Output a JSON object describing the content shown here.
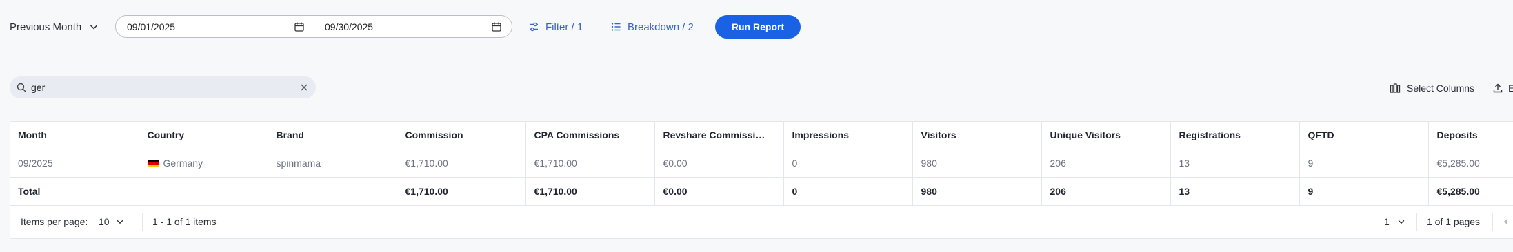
{
  "toolbar": {
    "period_label": "Previous Month",
    "date_from": "09/01/2025",
    "date_to": "09/30/2025",
    "filter_label": "Filter / 1",
    "breakdown_label": "Breakdown / 2",
    "run_label": "Run Report",
    "accent_color": "#1a62e5",
    "link_color": "#3a64c9"
  },
  "search": {
    "value": "ger",
    "icon": "search-icon"
  },
  "actions": {
    "select_columns_label": "Select Columns",
    "export_label": "E"
  },
  "table": {
    "columns": [
      "Month",
      "Country",
      "Brand",
      "Commission",
      "CPA Commissions",
      "Revshare Commissi…",
      "Impressions",
      "Visitors",
      "Unique Visitors",
      "Registrations",
      "QFTD",
      "Deposits"
    ],
    "rows": [
      {
        "month": "09/2025",
        "country": "Germany",
        "brand": "spinmama",
        "commission": "€1,710.00",
        "cpa": "€1,710.00",
        "revshare": "€0.00",
        "impressions": "0",
        "visitors": "980",
        "unique_visitors": "206",
        "registrations": "13",
        "qftd": "9",
        "deposits": "€5,285.00"
      }
    ],
    "total": {
      "label": "Total",
      "commission": "€1,710.00",
      "cpa": "€1,710.00",
      "revshare": "€0.00",
      "impressions": "0",
      "visitors": "980",
      "unique_visitors": "206",
      "registrations": "13",
      "qftd": "9",
      "deposits": "€5,285.00"
    }
  },
  "pager": {
    "items_per_page_label": "Items per page:",
    "items_per_page_value": "10",
    "range_text": "1 - 1 of 1 items",
    "current_page": "1",
    "pages_text": "1 of 1 pages"
  }
}
